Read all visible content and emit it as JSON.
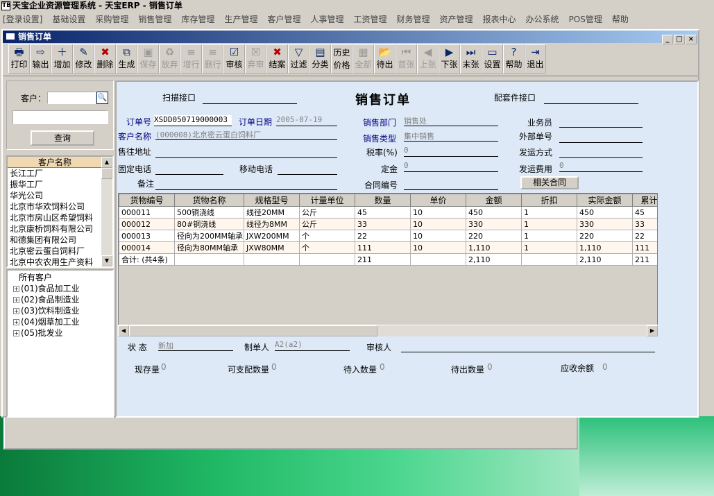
{
  "app_title": "天宝企业资源管理系统 - 天宝ERP - 销售订单",
  "app_logo": "TB",
  "menu": [
    "[登录设置]",
    "基础设置",
    "采购管理",
    "销售管理",
    "库存管理",
    "生产管理",
    "客户管理",
    "人事管理",
    "工资管理",
    "财务管理",
    "资产管理",
    "报表中心",
    "办公系统",
    "POS管理",
    "帮助"
  ],
  "window": {
    "title": "销售订单",
    "btn_min": "_",
    "btn_max": "□",
    "btn_close": "×"
  },
  "toolbar": [
    {
      "label": "打印",
      "icon": "printer-icon",
      "glyph": "🖶",
      "enabled": true
    },
    {
      "label": "输出",
      "icon": "export-icon",
      "glyph": "⇨",
      "enabled": true
    },
    {
      "label": "增加",
      "icon": "add-icon",
      "glyph": "＋",
      "enabled": true
    },
    {
      "label": "修改",
      "icon": "edit-icon",
      "glyph": "✎",
      "enabled": true
    },
    {
      "label": "删除",
      "icon": "delete-icon",
      "glyph": "✖",
      "enabled": true
    },
    {
      "label": "生成",
      "icon": "generate-icon",
      "glyph": "⧉",
      "enabled": true
    },
    {
      "label": "保存",
      "icon": "save-icon",
      "glyph": "▣",
      "enabled": false
    },
    {
      "label": "放弃",
      "icon": "discard-icon",
      "glyph": "♻",
      "enabled": false
    },
    {
      "label": "增行",
      "icon": "add-row-icon",
      "glyph": "≡",
      "enabled": false
    },
    {
      "label": "删行",
      "icon": "delete-row-icon",
      "glyph": "≡",
      "enabled": false
    },
    {
      "label": "审核",
      "icon": "approve-icon",
      "glyph": "☑",
      "enabled": true
    },
    {
      "label": "弃审",
      "icon": "unapprove-icon",
      "glyph": "☒",
      "enabled": false
    },
    {
      "label": "结案",
      "icon": "close-case-icon",
      "glyph": "✖",
      "enabled": true
    },
    {
      "label": "过滤",
      "icon": "filter-icon",
      "glyph": "▽",
      "enabled": true
    },
    {
      "label": "分类",
      "icon": "category-icon",
      "glyph": "▤",
      "enabled": true
    },
    {
      "label": "历史价格",
      "icon": "price-history-icon",
      "glyph": "",
      "enabled": true
    },
    {
      "label": "全部",
      "icon": "all-icon",
      "glyph": "▦",
      "enabled": false
    },
    {
      "label": "待出",
      "icon": "pending-out-icon",
      "glyph": "📂",
      "enabled": true
    },
    {
      "label": "首张",
      "icon": "first-record-icon",
      "glyph": "⏮",
      "enabled": false
    },
    {
      "label": "上张",
      "icon": "prev-record-icon",
      "glyph": "◀",
      "enabled": false
    },
    {
      "label": "下张",
      "icon": "next-record-icon",
      "glyph": "▶",
      "enabled": true
    },
    {
      "label": "末张",
      "icon": "last-record-icon",
      "glyph": "⏭",
      "enabled": true
    },
    {
      "label": "设置",
      "icon": "settings-icon",
      "glyph": "▭",
      "enabled": true
    },
    {
      "label": "帮助",
      "icon": "help-icon",
      "glyph": "?",
      "enabled": true
    },
    {
      "label": "退出",
      "icon": "exit-icon",
      "glyph": "⇥",
      "enabled": true
    }
  ],
  "search": {
    "customer_label": "客户：",
    "query_button": "查询",
    "search_icon_glyph": "🔍"
  },
  "customer_list": {
    "header": "客户名称",
    "items": [
      "长江工厂",
      "振华工厂",
      "华光公司",
      "北京市华欢饲料公司",
      "北京市房山区希望饲料",
      "北京康桥饲料有限公司",
      "和德集团有限公司",
      "北京密云蛋白饲料厂",
      "北京中农农用生产资料"
    ]
  },
  "tree": {
    "root": "所有客户",
    "items": [
      "(01)食品加工业",
      "(02)食品制造业",
      "(03)饮料制造业",
      "(04)烟草加工业",
      "(05)批发业"
    ]
  },
  "form": {
    "title": "销售订单",
    "scan_label": "扫描接口",
    "parts_label": "配套件接口",
    "order_no_label": "订单号",
    "order_no": "XSDD050719000003",
    "order_date_label": "订单日期",
    "order_date": "2005-07-19",
    "sales_dept_label": "销售部门",
    "sales_dept": "销售处",
    "salesman_label": "业务员",
    "customer_name_label": "客户名称",
    "customer_name": "(000008)北京密云蛋白饲料厂",
    "sales_type_label": "销售类型",
    "sales_type": "集中销售",
    "external_no_label": "外部单号",
    "address_label": "售往地址",
    "tax_label": "税率(%)",
    "tax": "0",
    "ship_method_label": "发运方式",
    "phone_label": "固定电话",
    "mobile_label": "移动电话",
    "deposit_label": "定金",
    "deposit": "0",
    "ship_fee_label": "发运费用",
    "ship_fee": "0",
    "remark_label": "备注",
    "contract_no_label": "合同编号",
    "contract_button": "相关合同"
  },
  "grid": {
    "columns": [
      "货物编号",
      "货物名称",
      "规格型号",
      "计量单位",
      "数量",
      "单价",
      "金额",
      "折扣",
      "实际金额",
      "累计发"
    ],
    "rows": [
      [
        "000011",
        "500铜浇线",
        "线径20MM",
        "公斤",
        "45",
        "10",
        "450",
        "1",
        "450",
        "45"
      ],
      [
        "000012",
        "80#铜浇线",
        "线径为8MM",
        "公斤",
        "33",
        "10",
        "330",
        "1",
        "330",
        "33"
      ],
      [
        "000013",
        "径向为200MM轴承",
        "JXW200MM",
        "个",
        "22",
        "10",
        "220",
        "1",
        "220",
        "22"
      ],
      [
        "000014",
        "径向为80MM轴承",
        "JXW80MM",
        "个",
        "111",
        "10",
        "1,110",
        "1",
        "1,110",
        "111"
      ]
    ],
    "total_row": [
      "合计: (共4条)",
      "",
      "",
      "",
      "211",
      "",
      "2,110",
      "",
      "2,110",
      "211"
    ]
  },
  "status": {
    "state_label": "状 态",
    "state": "新加",
    "maker_label": "制单人",
    "maker": "A2(a2)",
    "checker_label": "审核人",
    "stock_label": "现存量",
    "stock": "0",
    "available_label": "可支配数量",
    "available": "0",
    "pending_in_label": "待入数量",
    "pending_in": "0",
    "pending_out_label": "待出数量",
    "pending_out": "0",
    "receivable_label": "应收余额",
    "receivable": "0"
  }
}
